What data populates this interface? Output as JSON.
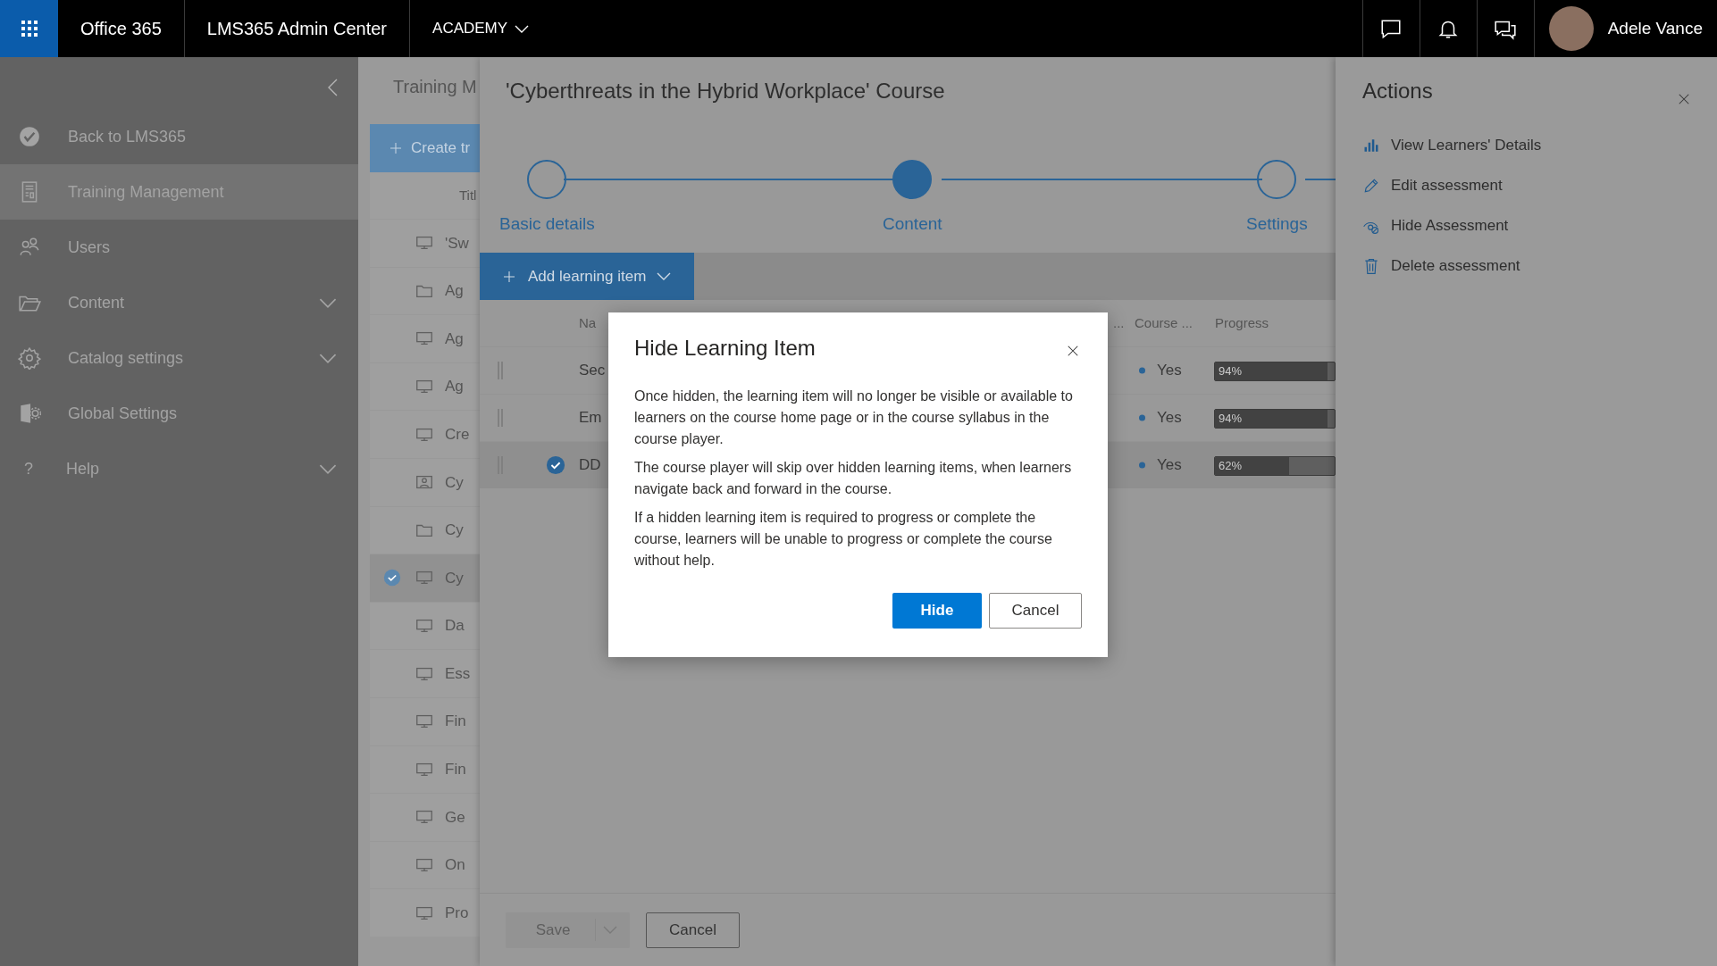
{
  "top_bar": {
    "app_name": "Office 365",
    "admin_center": "LMS365 Admin Center",
    "site_menu": "ACADEMY",
    "user_name": "Adele Vance"
  },
  "sidebar": {
    "items": [
      {
        "kind": "back",
        "label": "Back to LMS365",
        "selected": false
      },
      {
        "kind": "training",
        "label": "Training Management",
        "selected": true
      },
      {
        "kind": "users",
        "label": "Users",
        "selected": false
      },
      {
        "kind": "content",
        "label": "Content",
        "selected": false,
        "expanded": false
      },
      {
        "kind": "catalog",
        "label": "Catalog settings",
        "selected": false,
        "expanded": false
      },
      {
        "kind": "global",
        "label": "Global Settings",
        "selected": false
      },
      {
        "kind": "help",
        "icon_glyph": "?",
        "label": "Help",
        "selected": false,
        "expanded": false
      }
    ]
  },
  "training_list": {
    "title": "Training M",
    "create_button": "Create tr",
    "column_title": "Titl",
    "rows": [
      {
        "kind": "course",
        "title": "'Sw",
        "selected": false
      },
      {
        "kind": "folder",
        "title": "Ag",
        "selected": false
      },
      {
        "kind": "course",
        "title": "Ag",
        "selected": false
      },
      {
        "kind": "course",
        "title": "Ag",
        "selected": false
      },
      {
        "kind": "course",
        "title": "Cre",
        "selected": false
      },
      {
        "kind": "classroom",
        "title": "Cy",
        "selected": false
      },
      {
        "kind": "folder",
        "title": "Cy",
        "selected": false
      },
      {
        "kind": "course",
        "title": "Cy",
        "selected": true
      },
      {
        "kind": "course",
        "title": "Da",
        "selected": false
      },
      {
        "kind": "course",
        "title": "Ess",
        "selected": false
      },
      {
        "kind": "course",
        "title": "Fin",
        "selected": false
      },
      {
        "kind": "course",
        "title": "Fin",
        "selected": false
      },
      {
        "kind": "course",
        "title": "Ge",
        "selected": false
      },
      {
        "kind": "course",
        "title": "On",
        "selected": false
      },
      {
        "kind": "course",
        "title": "Pro",
        "selected": false
      }
    ]
  },
  "course_panel": {
    "title": "'Cyberthreats in the Hybrid Workplace' Course",
    "steps": [
      {
        "label": "Basic details",
        "selected": false
      },
      {
        "label": "Content",
        "selected": true
      },
      {
        "label": "Settings",
        "selected": false
      }
    ],
    "add_button": "Add learning item",
    "columns": [
      "Na",
      "...",
      "Course ...",
      "Progress"
    ],
    "rows": [
      {
        "name": "Sec",
        "course_required": "Yes",
        "progress": "94%",
        "level": 0.94,
        "selected": false
      },
      {
        "name": "Em",
        "course_required": "Yes",
        "progress": "94%",
        "level": 0.94,
        "selected": false
      },
      {
        "name": "DD",
        "course_required": "Yes",
        "progress": "62%",
        "level": 0.62,
        "selected": true
      }
    ],
    "save_button": "Save",
    "save_disabled": true,
    "cancel_button": "Cancel"
  },
  "actions_panel": {
    "title": "Actions",
    "items": [
      {
        "kind": "chart",
        "label": "View Learners' Details"
      },
      {
        "kind": "edit",
        "label": "Edit assessment"
      },
      {
        "kind": "hide",
        "label": "Hide Assessment"
      },
      {
        "kind": "delete",
        "label": "Delete assessment"
      }
    ]
  },
  "dialog": {
    "title": "Hide Learning Item",
    "paragraphs": [
      "Once hidden, the learning item will no longer be visible or available to learners on the course home page or in the course syllabus in the course player.",
      "The course player will skip over hidden learning items, when learners navigate back and forward in the course.",
      "If a hidden learning item is required to progress or complete the course, learners will be unable to progress or complete the course without help."
    ],
    "primary_button": "Hide",
    "secondary_button": "Cancel"
  }
}
